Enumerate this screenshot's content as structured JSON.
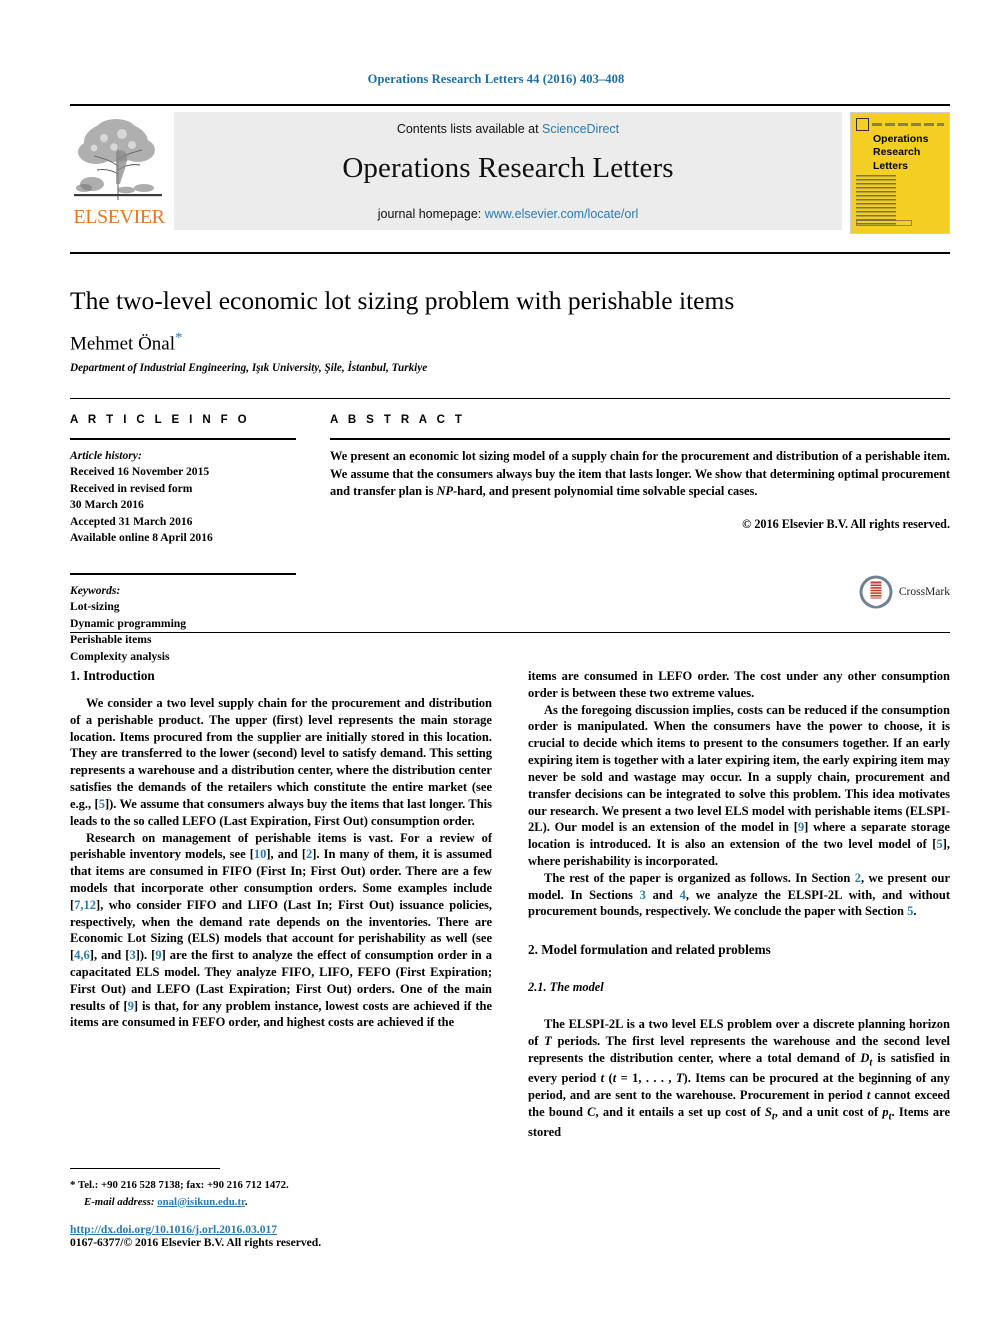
{
  "running_head": "Operations Research Letters 44 (2016) 403–408",
  "masthead": {
    "publisher_wordmark": "ELSEVIER",
    "contents_prefix": "Contents lists available at",
    "contents_link": "ScienceDirect",
    "journal_name": "Operations Research Letters",
    "homepage_prefix": "journal homepage:",
    "homepage_link": "www.elsevier.com/locate/orl",
    "cover_title_line1": "Operations",
    "cover_title_line2": "Research",
    "cover_title_line3": "Letters"
  },
  "article": {
    "title": "The two-level economic lot sizing problem with perishable items",
    "author": "Mehmet Önal",
    "author_marker": "*",
    "affiliation": "Department of Industrial Engineering, Işık University, Şile, İstanbul, Turkiye",
    "crossmark_label": "CrossMark"
  },
  "info": {
    "heading": "A R T I C L E    I N F O",
    "history_label": "Article history:",
    "history": [
      "Received 16 November 2015",
      "Received in revised form",
      "30 March 2016",
      "Accepted 31 March 2016",
      "Available online 8 April 2016"
    ],
    "keywords_label": "Keywords:",
    "keywords": [
      "Lot-sizing",
      "Dynamic programming",
      "Perishable items",
      "Complexity analysis"
    ]
  },
  "abstract": {
    "heading": "A B S T R A C T",
    "text_part1": "We present an economic lot sizing model of a supply chain for the procurement and distribution of a perishable item. We assume that the consumers always buy the item that lasts longer. We show that determining optimal procurement and transfer plan is ",
    "np_symbol": "NP",
    "text_part2": "-hard, and present polynomial time solvable special cases.",
    "copyright": "© 2016 Elsevier B.V. All rights reserved."
  },
  "body": {
    "section1_heading": "1. Introduction",
    "p1_a": "We consider a two level supply chain for the procurement and distribution of a perishable product. The upper (first) level represents the main storage location. Items procured from the supplier are initially stored in this location. They are transferred to the lower (second) level to satisfy demand. This setting represents a warehouse and a distribution center, where the distribution center satisfies the demands of the retailers which constitute the entire market (see e.g., [",
    "p1_ref1": "5",
    "p1_b": "]). We assume that consumers always buy the items that last longer. This leads to the so called LEFO (Last Expiration, First Out) consumption order.",
    "p2_a": "Research on management of perishable items is vast. For a review of perishable inventory models, see [",
    "p2_ref1": "10",
    "p2_b": "], and [",
    "p2_ref2": "2",
    "p2_c": "]. In many of them, it is assumed that items are consumed in FIFO (First In; First Out) order. There are a few models that incorporate other consumption orders. Some examples include [",
    "p2_ref3": "7,12",
    "p2_d": "], who consider FIFO and LIFO (Last In; First Out) issuance policies, respectively, when the demand rate depends on the inventories. There are Economic Lot Sizing (ELS) models that account for perishability as well (see [",
    "p2_ref4": "4,6",
    "p2_e": "], and [",
    "p2_ref5": "3",
    "p2_f": "]). [",
    "p2_ref6": "9",
    "p2_g": "] are the first to analyze the effect of consumption order in a capacitated ELS model. They analyze FIFO, LIFO, FEFO (First Expiration; First Out) and LEFO (Last Expiration; First Out) orders. One of the main results of [",
    "p2_ref7": "9",
    "p2_h": "] is that, for any problem instance, lowest costs are achieved if the items are consumed in FEFO order, and highest costs are achieved if the",
    "p3_a": "items are consumed in LEFO order. The cost under any other consumption order is between these two extreme values.",
    "p4_a": "As the foregoing discussion implies, costs can be reduced if the consumption order is manipulated. When the consumers have the power to choose, it is crucial to decide which items to present to the consumers together. If an early expiring item is together with a later expiring item, the early expiring item may never be sold and wastage may occur. In a supply chain, procurement and transfer decisions can be integrated to solve this problem. This idea motivates our research. We present a two level ELS model with perishable items (ELSPI-2L). Our model is an extension of the model in [",
    "p4_ref1": "9",
    "p4_b": "] where a separate storage location is introduced. It is also an extension of the two level model of [",
    "p4_ref2": "5",
    "p4_c": "], where perishability is incorporated.",
    "p5_a": "The rest of the paper is organized as follows. In Section ",
    "p5_ref1": "2",
    "p5_b": ", we present our model. In Sections ",
    "p5_ref2": "3",
    "p5_c": " and ",
    "p5_ref3": "4",
    "p5_d": ", we analyze the ELSPI-2L with, and without procurement bounds, respectively. We conclude the paper with Section ",
    "p5_ref4": "5",
    "p5_e": ".",
    "section2_heading": "2. Model formulation and related problems",
    "subsection21_heading": "2.1. The model",
    "p6_a": "The ELSPI-2L is a two level ELS problem over a discrete planning horizon of ",
    "p6_m1": "T",
    "p6_b": " periods. The first level represents the warehouse and the second level represents the distribution center, where a total demand of ",
    "p6_m2": "D",
    "p6_m2sub": "t",
    "p6_c": " is satisfied in every period ",
    "p6_m3": "t",
    "p6_d": " (",
    "p6_m4": "t",
    "p6_e": " = 1, . . . , ",
    "p6_m5": "T",
    "p6_f": "). Items can be procured at the beginning of any period, and are sent to the warehouse. Procurement in period ",
    "p6_m6": "t",
    "p6_g": " cannot exceed the bound ",
    "p6_m7": "C",
    "p6_h": ", and it entails a set up cost of ",
    "p6_m8": "S",
    "p6_m8sub": "t",
    "p6_i": ", and a unit cost of ",
    "p6_m9": "p",
    "p6_m9sub": "t",
    "p6_j": ". Items are stored"
  },
  "footnote": {
    "star": "*",
    "contact": "Tel.: +90 216 528 7138; fax: +90 216 712 1472.",
    "email_label": "E-mail address:",
    "email": "onal@isikun.edu.tr",
    "email_suffix": ".",
    "doi": "http://dx.doi.org/10.1016/j.orl.2016.03.017",
    "issn": "0167-6377/© 2016 Elsevier B.V. All rights reserved."
  },
  "colors": {
    "link_blue": "#2a7ab0",
    "header_blue": "#1b6ea8",
    "elsevier_orange": "#E87722",
    "cover_yellow": "#F5CE24",
    "banner_gray": "#ececec"
  }
}
